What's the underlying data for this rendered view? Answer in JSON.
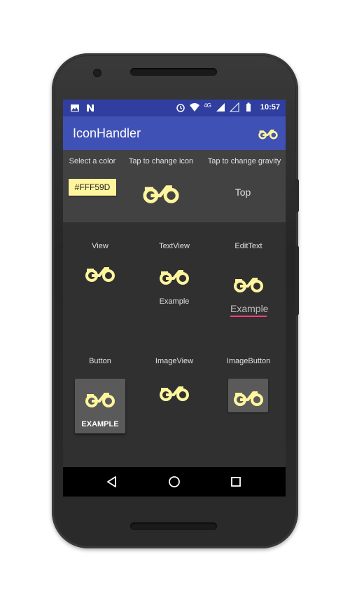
{
  "status_bar": {
    "time": "10:57",
    "network": "4G",
    "icons": [
      "image-icon",
      "n-icon",
      "alarm-icon",
      "wifi-icon",
      "signal-icon",
      "signal-empty-icon",
      "battery-icon"
    ]
  },
  "app_bar": {
    "title": "IconHandler",
    "action_icon": "motorcycle-icon",
    "color": "#3f51b5"
  },
  "controls": {
    "color_label": "Select a color",
    "color_value": "#FFF59D",
    "icon_label": "Tap to change icon",
    "gravity_label": "Tap to change gravity",
    "gravity_value": "Top"
  },
  "widgets": {
    "view_label": "View",
    "textview_label": "TextView",
    "textview_text": "Example",
    "edittext_label": "EditText",
    "edittext_text": "Example",
    "button_label": "Button",
    "button_text": "EXAMPLE",
    "imageview_label": "ImageView",
    "imagebutton_label": "ImageButton"
  },
  "colors": {
    "icon": "#fff59d",
    "accent": "#ff4081",
    "status_bar": "#303f9f"
  },
  "nav_bar": {
    "icons": [
      "back-icon",
      "home-icon",
      "recents-icon"
    ]
  }
}
